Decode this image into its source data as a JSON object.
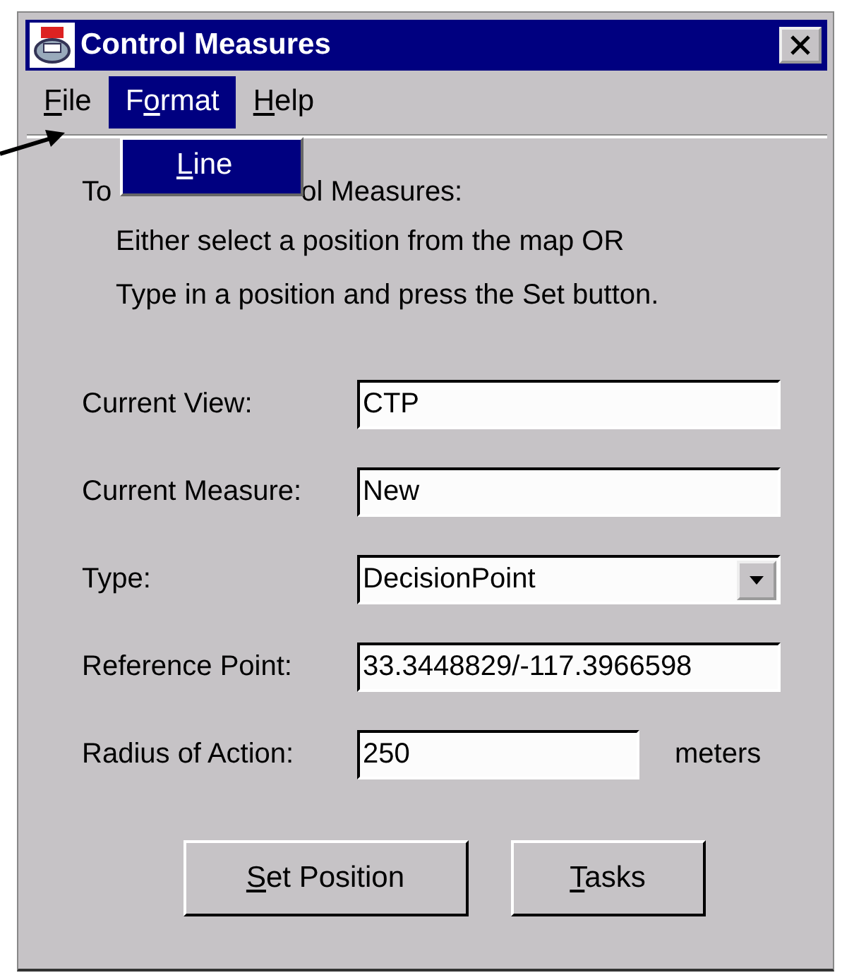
{
  "window": {
    "title": "Control Measures"
  },
  "menu": [
    {
      "mnemonic": "F",
      "label_rest": "ile",
      "selected": false
    },
    {
      "label_start": "F",
      "mnemonic": "o",
      "label_rest": "rmat",
      "selected": true
    },
    {
      "mnemonic": "H",
      "label_rest": "elp",
      "selected": false
    }
  ],
  "open_menu": {
    "items": [
      {
        "mnemonic": "L",
        "label_rest": "ine",
        "selected": true
      }
    ]
  },
  "instructions": {
    "line_1_start": "To",
    "line_1_end": "ol Measures:",
    "lines": [
      "Either select a position from the map OR",
      "Type in a position and press the Set button."
    ]
  },
  "fields": [
    {
      "label": "Current View:",
      "kind": "text",
      "value": "CTP"
    },
    {
      "label": "Current Measure:",
      "kind": "text",
      "value": "New"
    },
    {
      "label": "Type:",
      "kind": "combo",
      "value": "DecisionPoint"
    },
    {
      "label": "Reference Point:",
      "kind": "text",
      "value": "33.3448829/-117.3966598"
    },
    {
      "label": "Radius of Action:",
      "kind": "short",
      "value": "250",
      "unit": "meters"
    }
  ],
  "buttons": [
    {
      "mnemonic": "S",
      "label_rest": "et Position"
    },
    {
      "mnemonic": "T",
      "label_rest": "asks"
    }
  ]
}
